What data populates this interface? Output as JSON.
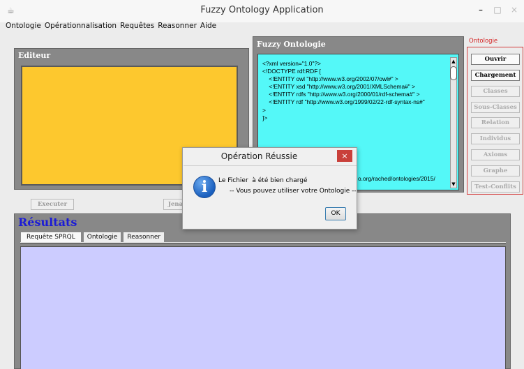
{
  "window": {
    "title": "Fuzzy Ontology Application",
    "icon": "app-icon",
    "controls": {
      "minimize": "–",
      "maximize": "□",
      "close": "×"
    }
  },
  "menubar": {
    "items": [
      "Ontologie",
      "Opérationnalisation",
      "Requêtes",
      "Reasonner",
      "Aide"
    ]
  },
  "editeur": {
    "title": "Editeur",
    "content": "",
    "bg_color": "#fdc82e"
  },
  "fuzzy": {
    "title": "Fuzzy Ontologie",
    "bg_color": "#54f8f8",
    "lines": [
      "<?xml version=\"1.0\"?>",
      "",
      "",
      "<!DOCTYPE rdf:RDF [",
      "    <!ENTITY owl \"http://www.w3.org/2002/07/owl#\" >",
      "    <!ENTITY xsd \"http://www.w3.org/2001/XMLSchema#\" >",
      "    <!ENTITY rdfs \"http://www.w3.org/2000/01/rdf-schema#\" >",
      "    <!ENTITY rdf \"http://www.w3.org/1999/02/22-rdf-syntax-ns#\"",
      ">",
      "]>"
    ],
    "tail": "o.org/rached/ontologies/2015/"
  },
  "ontologie_panel": {
    "label": "Ontologie",
    "buttons": [
      {
        "label": "Ouvrir",
        "enabled": true
      },
      {
        "label": "Chargement",
        "enabled": true
      },
      {
        "label": "Classes",
        "enabled": false
      },
      {
        "label": "Sous-Classes",
        "enabled": false
      },
      {
        "label": "Relation",
        "enabled": false
      },
      {
        "label": "Individus",
        "enabled": false
      },
      {
        "label": "Axioms",
        "enabled": false
      },
      {
        "label": "Graphe",
        "enabled": false
      },
      {
        "label": "Test-Conflits",
        "enabled": false
      }
    ]
  },
  "actions": {
    "executer": "Executer",
    "jena": "Jena"
  },
  "results": {
    "title": "Résultats",
    "tabs": [
      "Requête SPRQL",
      "Ontologie",
      "Reasonner"
    ],
    "selected_tab": 0,
    "bg_color": "#ccccff"
  },
  "dialog": {
    "title": "Opération Réussie",
    "close": "×",
    "icon": "info-icon",
    "icon_glyph": "i",
    "message_line1": "Le Fichier  à été bien chargé",
    "message_line2": "-- Vous pouvez utiliser votre Ontologie --",
    "ok": "OK"
  }
}
